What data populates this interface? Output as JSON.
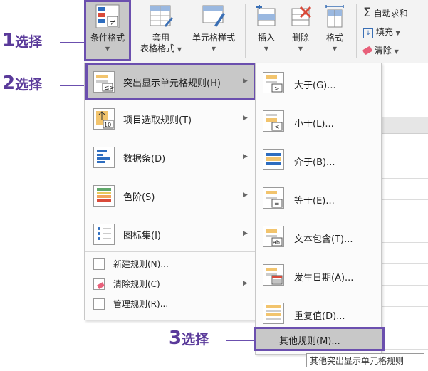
{
  "steps": [
    {
      "num": "1",
      "text": "选择"
    },
    {
      "num": "2",
      "text": "选择"
    },
    {
      "num": "3",
      "text": "选择"
    }
  ],
  "ribbon": {
    "conditional_format": "条件格式",
    "table_format_line1": "套用",
    "table_format_line2": "表格格式",
    "cell_styles": "单元格样式",
    "insert": "插入",
    "delete": "删除",
    "format": "格式",
    "autosum": "自动求和",
    "fill": "填充",
    "clear": "清除"
  },
  "main_menu": {
    "items": [
      {
        "label": "突出显示单元格规则(H)",
        "icon": "highlight-rules-icon"
      },
      {
        "label": "项目选取规则(T)",
        "icon": "top-bottom-rules-icon"
      },
      {
        "label": "数据条(D)",
        "icon": "data-bars-icon"
      },
      {
        "label": "色阶(S)",
        "icon": "color-scales-icon"
      },
      {
        "label": "图标集(I)",
        "icon": "icon-sets-icon"
      }
    ],
    "small_items": [
      {
        "label": "新建规则(N)...",
        "icon": "new-rule-icon"
      },
      {
        "label": "清除规则(C)",
        "icon": "clear-rules-icon"
      },
      {
        "label": "管理规则(R)...",
        "icon": "manage-rules-icon"
      }
    ]
  },
  "sub_menu": {
    "items": [
      {
        "label": "大于(G)...",
        "icon": "greater-than-icon"
      },
      {
        "label": "小于(L)...",
        "icon": "less-than-icon"
      },
      {
        "label": "介于(B)...",
        "icon": "between-icon"
      },
      {
        "label": "等于(E)...",
        "icon": "equal-to-icon"
      },
      {
        "label": "文本包含(T)...",
        "icon": "text-contains-icon"
      },
      {
        "label": "发生日期(A)...",
        "icon": "date-occurring-icon"
      },
      {
        "label": "重复值(D)...",
        "icon": "duplicate-values-icon"
      }
    ],
    "more_rules": "其他规则(M)..."
  },
  "tooltip": "其他突出显示单元格规则",
  "colors": {
    "accent": "#6b4fae",
    "highlight": "#c8c8c8"
  }
}
